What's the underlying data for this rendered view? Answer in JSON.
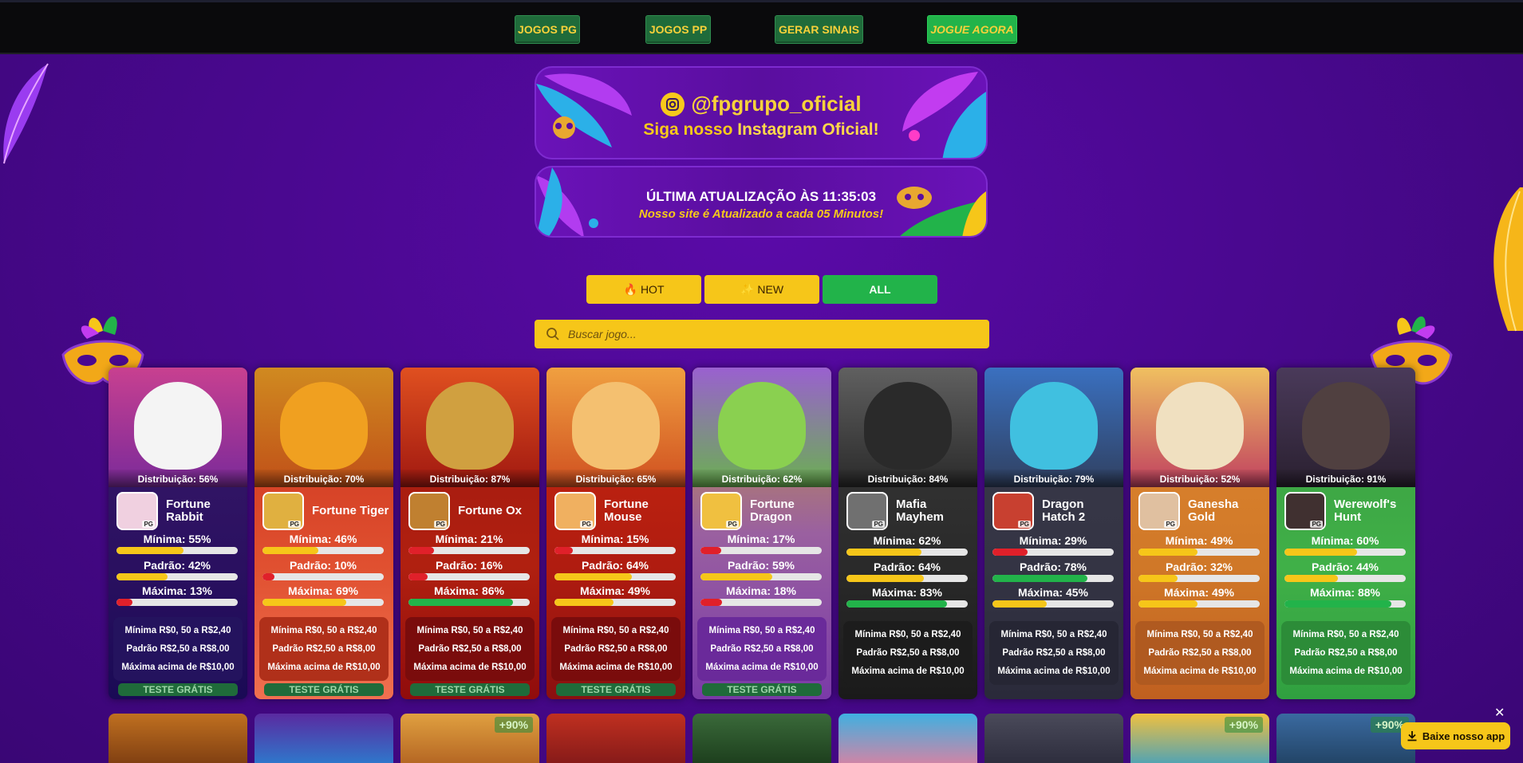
{
  "nav": {
    "jogos_pg": "JOGOS PG",
    "jogos_pp": "JOGOS PP",
    "gerar_sinais": "GERAR SINAIS",
    "jogue_agora": "JOGUE AGORA"
  },
  "banner_instagram": {
    "handle": "@fpgrupo_oficial",
    "sub_prefix": "Siga nosso ",
    "sub_bold": "Instagram Oficial!"
  },
  "banner_update": {
    "title": "ÚLTIMA ATUALIZAÇÃO ÀS 11:35:03",
    "sub_prefix": "Nosso site é Atualizado ",
    "sub_bold": "a cada 05 Minutos!"
  },
  "filters": {
    "hot": "HOT",
    "new": "NEW",
    "all": "ALL"
  },
  "search": {
    "placeholder": "Buscar jogo..."
  },
  "cards": [
    {
      "name": "Fortune Rabbit",
      "distribution": "Distribuição: 56%",
      "min_label": "Mínima: 55%",
      "min": 55,
      "pad_label": "Padrão: 42%",
      "pad": 42,
      "max_label": "Máxima: 13%",
      "max": 13,
      "test": "TESTE GRÁTIS"
    },
    {
      "name": "Fortune Tiger",
      "distribution": "Distribuição: 70%",
      "min_label": "Mínima: 46%",
      "min": 46,
      "pad_label": "Padrão: 10%",
      "pad": 10,
      "max_label": "Máxima: 69%",
      "max": 69,
      "test": "TESTE GRÁTIS"
    },
    {
      "name": "Fortune Ox",
      "distribution": "Distribuição: 87%",
      "min_label": "Mínima: 21%",
      "min": 21,
      "pad_label": "Padrão: 16%",
      "pad": 16,
      "max_label": "Máxima: 86%",
      "max": 86,
      "test": "TESTE GRÁTIS"
    },
    {
      "name": "Fortune Mouse",
      "distribution": "Distribuição: 65%",
      "min_label": "Mínima: 15%",
      "min": 15,
      "pad_label": "Padrão: 64%",
      "pad": 64,
      "max_label": "Máxima: 49%",
      "max": 49,
      "test": "TESTE GRÁTIS"
    },
    {
      "name": "Fortune Dragon",
      "distribution": "Distribuição: 62%",
      "min_label": "Mínima: 17%",
      "min": 17,
      "pad_label": "Padrão: 59%",
      "pad": 59,
      "max_label": "Máxima: 18%",
      "max": 18,
      "test": "TESTE GRÁTIS"
    },
    {
      "name": "Mafia Mayhem",
      "distribution": "Distribuição: 84%",
      "min_label": "Mínima: 62%",
      "min": 62,
      "pad_label": "Padrão: 64%",
      "pad": 64,
      "max_label": "Máxima: 83%",
      "max": 83,
      "test": ""
    },
    {
      "name": "Dragon Hatch 2",
      "distribution": "Distribuição: 79%",
      "min_label": "Mínima: 29%",
      "min": 29,
      "pad_label": "Padrão: 78%",
      "pad": 78,
      "max_label": "Máxima: 45%",
      "max": 45,
      "test": ""
    },
    {
      "name": "Ganesha Gold",
      "distribution": "Distribuição: 52%",
      "min_label": "Mínima: 49%",
      "min": 49,
      "pad_label": "Padrão: 32%",
      "pad": 32,
      "max_label": "Máxima: 49%",
      "max": 49,
      "test": ""
    },
    {
      "name": "Werewolf's Hunt",
      "distribution": "Distribuição: 91%",
      "min_label": "Mínima: 60%",
      "min": 60,
      "pad_label": "Padrão: 44%",
      "pad": 44,
      "max_label": "Máxima: 88%",
      "max": 88,
      "test": ""
    }
  ],
  "bet_info": {
    "minima": "Mínima R$0, 50 a R$2,40",
    "padrao": "Padrão R$2,50 a R$8,00",
    "maxima": "Máxima acima de R$10,00"
  },
  "bottom_badges": [
    "+90%",
    "+90%",
    "+90%"
  ],
  "app": {
    "download": "Baixe nosso app",
    "close": "✕"
  },
  "colors": {
    "bar_green": "#22b34a",
    "bar_yellow": "#f6c619",
    "bar_red": "#e0202a"
  }
}
